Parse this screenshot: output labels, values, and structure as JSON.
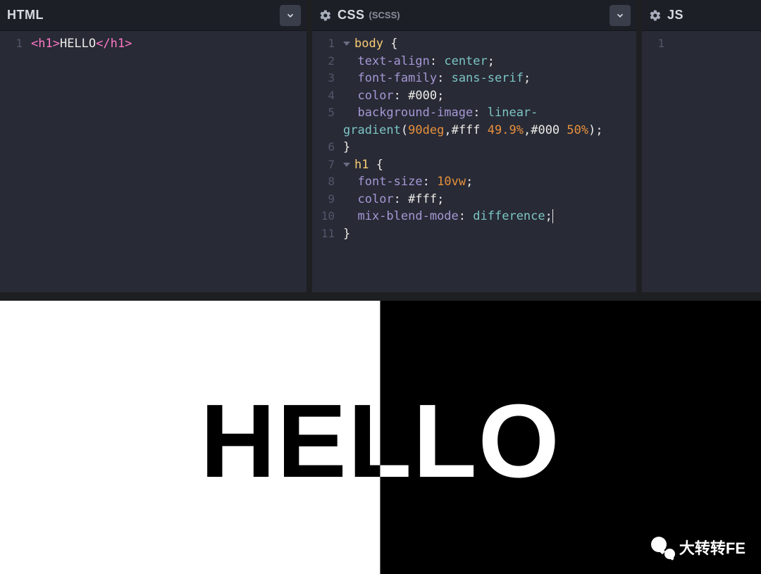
{
  "panels": {
    "html": {
      "title": "HTML",
      "has_gear": false,
      "has_chevron": true,
      "code": [
        {
          "n": 1,
          "html": "<span class='c-tag'>&lt;h1&gt;</span><span class='c-text'>HELLO</span><span class='c-tag'>&lt;/h1&gt;</span>"
        }
      ]
    },
    "css": {
      "title": "CSS",
      "subtitle": "(SCSS)",
      "has_gear": true,
      "has_chevron": true,
      "code": [
        {
          "n": 1,
          "fold": true,
          "html": "<span class='c-sel'>body</span> <span class='c-brace'>{</span>"
        },
        {
          "n": 2,
          "html": "  <span class='c-prop'>text-align</span><span class='c-punc'>:</span> <span class='c-val'>center</span><span class='c-punc'>;</span>"
        },
        {
          "n": 3,
          "html": "  <span class='c-prop'>font-family</span><span class='c-punc'>:</span> <span class='c-val'>sans-serif</span><span class='c-punc'>;</span>"
        },
        {
          "n": 4,
          "html": "  <span class='c-prop'>color</span><span class='c-punc'>:</span> <span class='c-hex'>#000</span><span class='c-punc'>;</span>"
        },
        {
          "n": 5,
          "html": "  <span class='c-prop'>background-image</span><span class='c-punc'>:</span> <span class='c-val'>linear-</span>"
        },
        {
          "n": "",
          "html": "<span class='c-val'>gradient</span><span class='c-punc'>(</span><span class='c-num'>90deg</span><span class='c-punc'>,</span><span class='c-hex'>#fff</span> <span class='c-num'>49.9%</span><span class='c-punc'>,</span><span class='c-hex'>#000</span> <span class='c-num'>50%</span><span class='c-punc'>);</span>"
        },
        {
          "n": 6,
          "html": "<span class='c-brace'>}</span>"
        },
        {
          "n": 7,
          "fold": true,
          "html": "<span class='c-sel'>h1</span> <span class='c-brace'>{</span>"
        },
        {
          "n": 8,
          "html": "  <span class='c-prop'>font-size</span><span class='c-punc'>:</span> <span class='c-num'>10vw</span><span class='c-punc'>;</span>"
        },
        {
          "n": 9,
          "html": "  <span class='c-prop'>color</span><span class='c-punc'>:</span> <span class='c-hex'>#fff</span><span class='c-punc'>;</span>"
        },
        {
          "n": 10,
          "html": "  <span class='c-prop'>mix-blend-mode</span><span class='c-punc'>:</span> <span class='c-val'>difference</span><span class='c-punc c-cursor'>;</span>"
        },
        {
          "n": 11,
          "html": "<span class='c-brace'>}</span>"
        }
      ]
    },
    "js": {
      "title": "JS",
      "has_gear": true,
      "has_chevron": false,
      "code": [
        {
          "n": 1,
          "html": ""
        }
      ]
    }
  },
  "output": {
    "heading_text": "HELLO"
  },
  "watermark": {
    "text": "大转转FE"
  }
}
